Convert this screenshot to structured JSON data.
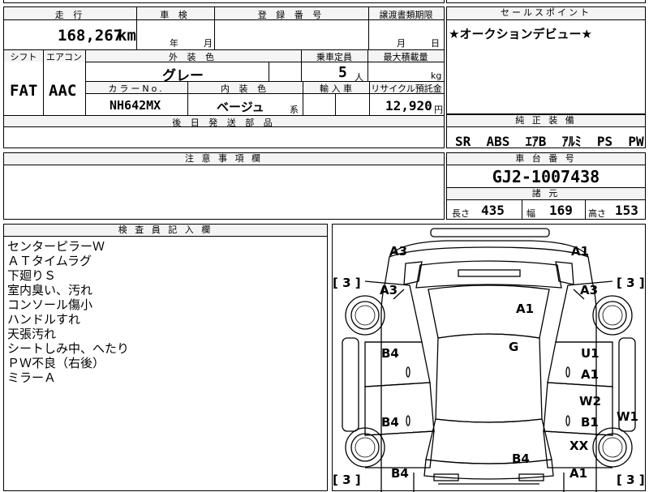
{
  "top_strip": [
    "",
    "",
    "",
    ""
  ],
  "mileage": {
    "label": "走 行",
    "value": "168,267",
    "unit": "km"
  },
  "inspection": {
    "label": "車 検",
    "year_unit": "年",
    "month_unit": "月"
  },
  "registration": {
    "label": "登 録 番 号",
    "value": ""
  },
  "transfer_deadline": {
    "label": "譲渡書類期限",
    "month_unit": "月",
    "day_unit": "日"
  },
  "shift": {
    "label": "シフト",
    "value": "FAT"
  },
  "aircon": {
    "label": "エアコン",
    "value": "AAC"
  },
  "exterior_color": {
    "label": "外 装 色",
    "value": "グレー"
  },
  "capacity": {
    "label": "乗車定員",
    "value": "5",
    "unit": "人"
  },
  "max_load": {
    "label": "最大積載量",
    "unit": "kg"
  },
  "color_no": {
    "label": "カラーNo.",
    "value": "NH642MX"
  },
  "interior_color": {
    "label": "内 装 色",
    "value": "ベージュ",
    "suffix": "系"
  },
  "import": {
    "label": "輸 入 車"
  },
  "recycle_fee": {
    "label": "リサイクル預託金",
    "value": "12,920",
    "unit": "円"
  },
  "later_parts": {
    "label": "後 日 発 送 部 品"
  },
  "sales_point": {
    "label": "セールスポイント",
    "value": "★オークションデビュー★"
  },
  "equipment": {
    "label": "純 正 装 備",
    "items": [
      "SR",
      "ABS",
      "ｴｱB",
      "ｱﾙﾐ",
      "PS",
      "PW"
    ]
  },
  "caution": {
    "label": "注 意 事 項 欄"
  },
  "chassis": {
    "label": "車 台 番 号",
    "value": "GJ2-1007438"
  },
  "dimensions": {
    "label": "諸 元",
    "length_label": "長さ",
    "length": "435",
    "width_label": "幅",
    "width": "169",
    "height_label": "高さ",
    "height": "153"
  },
  "inspector_notes": {
    "label": "検 査 員 記 入 欄",
    "lines": [
      "センターピラーＷ",
      "ＡＴタイムラグ",
      "下廻りＳ",
      "室内臭い、汚れ",
      "コンソール傷小",
      "ハンドルすれ",
      "天張汚れ",
      "シートしみ中、へたり",
      "ＰＷ不良（右後）",
      "ミラーＡ"
    ]
  },
  "damage": {
    "front_left": "A3",
    "front_right": "A1",
    "fender_left": "A3",
    "fender_right": "A3",
    "hood": "A1",
    "roof": "G",
    "front_door_left": "B4",
    "front_door_right_1": "U1",
    "front_door_right_2": "A1",
    "rear_door_left": "B4",
    "rear_door_right_1": "W2",
    "rear_door_right_2": "B1",
    "side_sill_right": "W1",
    "wheel_rear_right": "XX",
    "trunk": "B4",
    "rear_left": "B4",
    "rear_right": "A1",
    "tire_front_left": "3",
    "tire_front_right": "3",
    "tire_rear_left": "3",
    "tire_rear_right": "3"
  }
}
